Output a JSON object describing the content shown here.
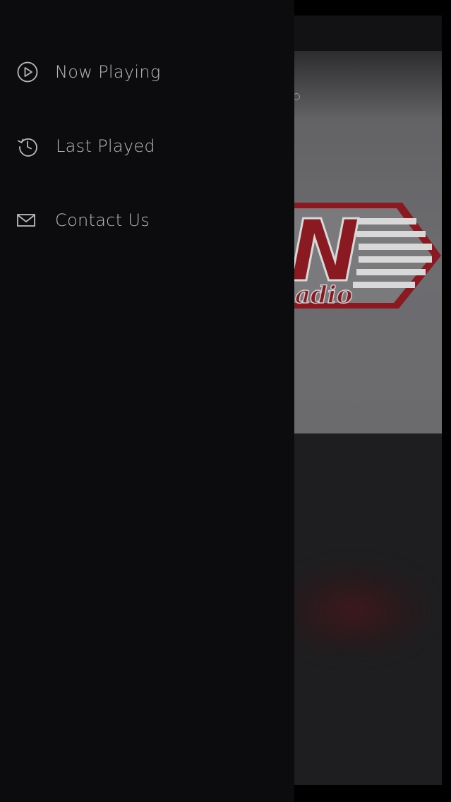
{
  "drawer": {
    "items": [
      {
        "label": "Now Playing",
        "icon": "play-circle-icon"
      },
      {
        "label": "Last Played",
        "icon": "history-icon"
      },
      {
        "label": "Contact Us",
        "icon": "mail-icon"
      }
    ]
  },
  "background": {
    "logo_text": "N",
    "logo_subtext": "adio"
  },
  "colors": {
    "drawer_bg": "#0c0b0d",
    "menu_text": "#b9b9bd",
    "logo_red": "#8a1a22"
  }
}
